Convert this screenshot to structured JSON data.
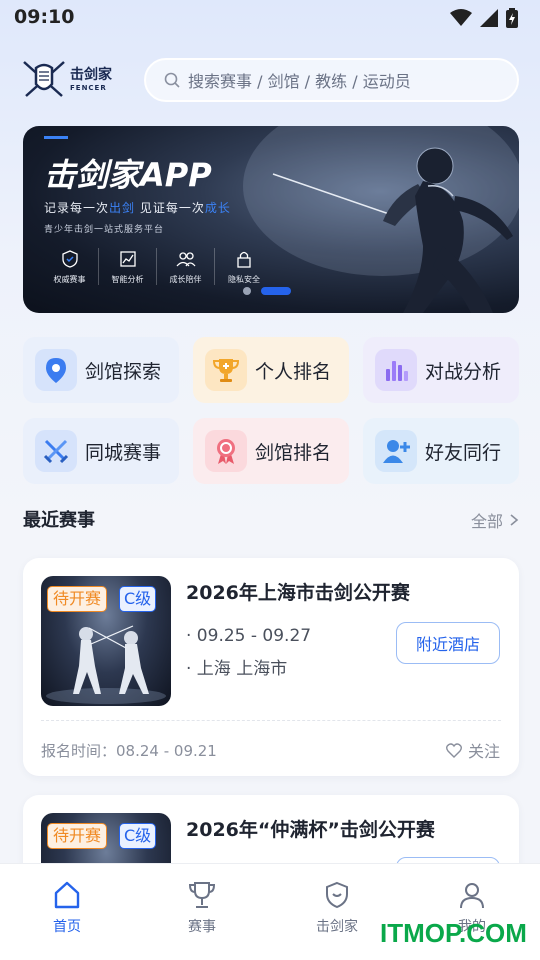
{
  "status_bar": {
    "time": "09:10"
  },
  "header": {
    "logo_text": "击剑家",
    "logo_sub": "FENCER",
    "search_placeholder": "搜索赛事 / 剑馆 / 教练 / 运动员"
  },
  "banner": {
    "title": "击剑家APP",
    "slogan_a": "记录每一次",
    "slogan_b": "出剑",
    "slogan_c": "  见证每一次",
    "slogan_d": "成长",
    "subtitle": "青少年击剑一站式服务平台",
    "features": [
      {
        "icon": "shield-check-icon",
        "label": "权威赛事"
      },
      {
        "icon": "chart-icon",
        "label": "智能分析"
      },
      {
        "icon": "people-icon",
        "label": "成长陪伴"
      },
      {
        "icon": "lock-icon",
        "label": "隐私安全"
      }
    ]
  },
  "quick_menu": [
    {
      "icon": "location-pin-icon",
      "label": "剑馆探索",
      "bg": "#eaf0fb"
    },
    {
      "icon": "trophy-icon",
      "label": "个人排名",
      "bg": "#fcf2e2"
    },
    {
      "icon": "bar-chart-icon",
      "label": "对战分析",
      "bg": "#efedfb"
    },
    {
      "icon": "crossed-swords-icon",
      "label": "同城赛事",
      "bg": "#eaf0fb"
    },
    {
      "icon": "medal-icon",
      "label": "剑馆排名",
      "bg": "#fbecee"
    },
    {
      "icon": "add-friend-icon",
      "label": "好友同行",
      "bg": "#e9f2fb"
    }
  ],
  "recent": {
    "title": "最近赛事",
    "more": "全部"
  },
  "events": [
    {
      "status": "待开赛",
      "level": "C级",
      "title": "2026年上海市击剑公开赛",
      "date": "· 09.25 - 09.27",
      "location": "· 上海 上海市",
      "hotel": "附近酒店",
      "reg_label": "报名时间：",
      "reg_time": "08.24 - 09.21",
      "follow": "关注"
    },
    {
      "status": "待开赛",
      "level": "C级",
      "title": "2026年“仲满杯”击剑公开赛"
    }
  ],
  "tabbar": [
    {
      "icon": "home-icon",
      "label": "首页",
      "active": true
    },
    {
      "icon": "trophy-outline-icon",
      "label": "赛事",
      "active": false
    },
    {
      "icon": "shield-outline-icon",
      "label": "击剑家",
      "active": false
    },
    {
      "icon": "person-icon",
      "label": "我的",
      "active": false
    }
  ],
  "watermark": "ITMOP.COM",
  "colors": {
    "accent": "#2563eb",
    "orange": "#f08a24"
  }
}
